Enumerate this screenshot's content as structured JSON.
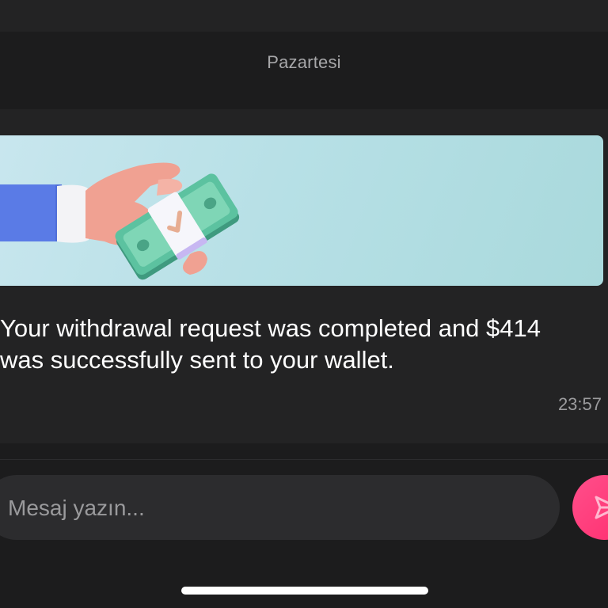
{
  "header": {
    "date_label": "Pazartesi"
  },
  "message": {
    "banner_icon": "hand-holding-money-icon",
    "text": "Your withdrawal request was completed and $414 was successfully sent to your wallet.",
    "time": "23:57"
  },
  "composer": {
    "placeholder": "Mesaj yazın...",
    "value": "",
    "send_icon": "send-icon"
  },
  "colors": {
    "background": "#1c1c1d",
    "card": "#232324",
    "accent": "#ff3d7f",
    "banner": "#b7e0e6"
  }
}
